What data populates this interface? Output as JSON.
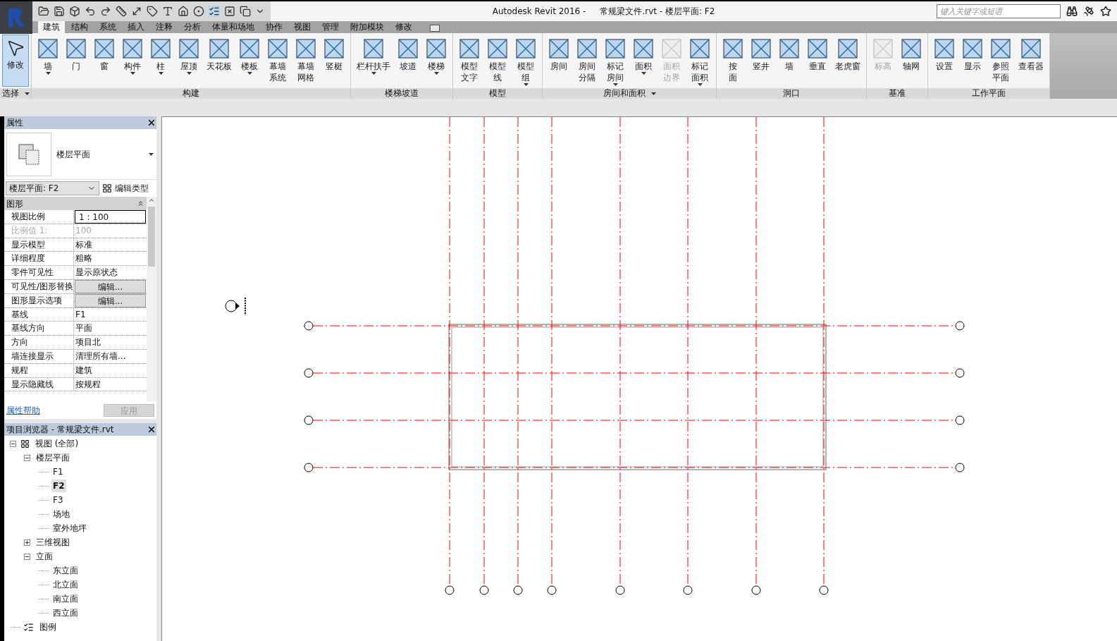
{
  "window": {
    "app_title": "Autodesk Revit 2016 -",
    "document_title": "常规梁文件.rvt - 楼层平面: F2"
  },
  "search": {
    "placeholder": "键入关键字或短语"
  },
  "tabs": [
    {
      "label": "建筑",
      "selected": true
    },
    {
      "label": "结构",
      "selected": false
    },
    {
      "label": "系统",
      "selected": false
    },
    {
      "label": "插入",
      "selected": false
    },
    {
      "label": "注释",
      "selected": false
    },
    {
      "label": "分析",
      "selected": false
    },
    {
      "label": "体量和场地",
      "selected": false
    },
    {
      "label": "协作",
      "selected": false
    },
    {
      "label": "视图",
      "selected": false
    },
    {
      "label": "管理",
      "selected": false
    },
    {
      "label": "附加模块",
      "selected": false
    },
    {
      "label": "修改",
      "selected": false
    }
  ],
  "ribbon": {
    "panels": [
      {
        "label": "选择",
        "menu": true,
        "buttons": [
          {
            "lines": [
              "修改"
            ],
            "menu": false,
            "disabled": false,
            "active": true
          }
        ]
      },
      {
        "label": "构建",
        "menu": false,
        "buttons": [
          {
            "lines": [
              "墙"
            ],
            "menu": true,
            "disabled": false,
            "active": false
          },
          {
            "lines": [
              "门"
            ],
            "menu": false,
            "disabled": false,
            "active": false
          },
          {
            "lines": [
              "窗"
            ],
            "menu": false,
            "disabled": false,
            "active": false
          },
          {
            "lines": [
              "构件"
            ],
            "menu": true,
            "disabled": false,
            "active": false
          },
          {
            "lines": [
              "柱"
            ],
            "menu": true,
            "disabled": false,
            "active": false
          },
          {
            "lines": [
              "屋顶"
            ],
            "menu": true,
            "disabled": false,
            "active": false
          },
          {
            "lines": [
              "天花板"
            ],
            "menu": false,
            "disabled": false,
            "active": false
          },
          {
            "lines": [
              "楼板"
            ],
            "menu": true,
            "disabled": false,
            "active": false
          },
          {
            "lines": [
              "幕墙",
              "系统"
            ],
            "menu": false,
            "disabled": false,
            "active": false
          },
          {
            "lines": [
              "幕墙",
              "网格"
            ],
            "menu": false,
            "disabled": false,
            "active": false
          },
          {
            "lines": [
              "竖梃"
            ],
            "menu": false,
            "disabled": false,
            "active": false
          }
        ]
      },
      {
        "label": "楼梯坡道",
        "menu": false,
        "buttons": [
          {
            "lines": [
              "栏杆扶手"
            ],
            "menu": true,
            "disabled": false,
            "active": false
          },
          {
            "lines": [
              "坡道"
            ],
            "menu": false,
            "disabled": false,
            "active": false
          },
          {
            "lines": [
              "楼梯"
            ],
            "menu": true,
            "disabled": false,
            "active": false
          }
        ]
      },
      {
        "label": "模型",
        "menu": false,
        "buttons": [
          {
            "lines": [
              "模型",
              "文字"
            ],
            "menu": false,
            "disabled": false,
            "active": false
          },
          {
            "lines": [
              "模型",
              "线"
            ],
            "menu": false,
            "disabled": false,
            "active": false
          },
          {
            "lines": [
              "模型",
              "组"
            ],
            "menu": true,
            "disabled": false,
            "active": false
          }
        ]
      },
      {
        "label": "房间和面积",
        "menu": true,
        "buttons": [
          {
            "lines": [
              "房间"
            ],
            "menu": false,
            "disabled": false,
            "active": false
          },
          {
            "lines": [
              "房间",
              "分隔"
            ],
            "menu": false,
            "disabled": false,
            "active": false
          },
          {
            "lines": [
              "标记",
              "房间"
            ],
            "menu": true,
            "disabled": false,
            "active": false
          },
          {
            "lines": [
              "面积"
            ],
            "menu": true,
            "disabled": false,
            "active": false
          },
          {
            "lines": [
              "面积",
              "边界"
            ],
            "menu": false,
            "disabled": true,
            "active": false
          },
          {
            "lines": [
              "标记",
              "面积"
            ],
            "menu": true,
            "disabled": false,
            "active": false
          }
        ]
      },
      {
        "label": "洞口",
        "menu": false,
        "buttons": [
          {
            "lines": [
              "按",
              "面"
            ],
            "menu": false,
            "disabled": false,
            "active": false
          },
          {
            "lines": [
              "竖井"
            ],
            "menu": false,
            "disabled": false,
            "active": false
          },
          {
            "lines": [
              "墙"
            ],
            "menu": false,
            "disabled": false,
            "active": false
          },
          {
            "lines": [
              "垂直"
            ],
            "menu": false,
            "disabled": false,
            "active": false
          },
          {
            "lines": [
              "老虎窗"
            ],
            "menu": false,
            "disabled": false,
            "active": false
          }
        ]
      },
      {
        "label": "基准",
        "menu": false,
        "buttons": [
          {
            "lines": [
              "标高"
            ],
            "menu": false,
            "disabled": true,
            "active": false
          },
          {
            "lines": [
              "轴网"
            ],
            "menu": false,
            "disabled": false,
            "active": false
          }
        ]
      },
      {
        "label": "工作平面",
        "menu": false,
        "buttons": [
          {
            "lines": [
              "设置"
            ],
            "menu": false,
            "disabled": false,
            "active": false
          },
          {
            "lines": [
              "显示"
            ],
            "menu": false,
            "disabled": false,
            "active": false
          },
          {
            "lines": [
              "参照",
              "平面"
            ],
            "menu": false,
            "disabled": false,
            "active": false
          },
          {
            "lines": [
              "查看器"
            ],
            "menu": false,
            "disabled": false,
            "active": false
          }
        ]
      }
    ]
  },
  "properties": {
    "title": "属性",
    "type_name": "楼层平面",
    "instance_selector": "楼层平面: F2",
    "edit_type": "编辑类型",
    "group": "图形",
    "rows": [
      {
        "name": "视图比例",
        "value": "1 : 100",
        "kind": "input",
        "disabled": false
      },
      {
        "name": "比例值 1:",
        "value": "100",
        "kind": "text",
        "disabled": true
      },
      {
        "name": "显示模型",
        "value": "标准",
        "kind": "text",
        "disabled": false
      },
      {
        "name": "详细程度",
        "value": "粗略",
        "kind": "text",
        "disabled": false
      },
      {
        "name": "零件可见性",
        "value": "显示原状态",
        "kind": "text",
        "disabled": false
      },
      {
        "name": "可见性/图形替换",
        "value": "编辑...",
        "kind": "button",
        "disabled": false
      },
      {
        "name": "图形显示选项",
        "value": "编辑...",
        "kind": "button",
        "disabled": false
      },
      {
        "name": "基线",
        "value": "F1",
        "kind": "text",
        "disabled": false
      },
      {
        "name": "基线方向",
        "value": "平面",
        "kind": "text",
        "disabled": false
      },
      {
        "name": "方向",
        "value": "项目北",
        "kind": "text",
        "disabled": false
      },
      {
        "name": "墙连接显示",
        "value": "清理所有墙...",
        "kind": "text",
        "disabled": false
      },
      {
        "name": "规程",
        "value": "建筑",
        "kind": "text",
        "disabled": false
      },
      {
        "name": "显示隐藏线",
        "value": "按规程",
        "kind": "text",
        "disabled": false
      }
    ],
    "help_link": "属性帮助",
    "apply": {
      "label": "应用",
      "disabled": true
    }
  },
  "browser": {
    "title": "项目浏览器 - 常规梁文件.rvt",
    "tree": [
      {
        "label": "视图 (全部)",
        "kind": "views",
        "expanded": true,
        "selected": false,
        "children": [
          {
            "label": "楼层平面",
            "expanded": true,
            "selected": false,
            "children": [
              {
                "label": "F1",
                "selected": false
              },
              {
                "label": "F2",
                "selected": true
              },
              {
                "label": "F3",
                "selected": false
              },
              {
                "label": "场地",
                "selected": false
              },
              {
                "label": "室外地坪",
                "selected": false
              }
            ]
          },
          {
            "label": "三维视图",
            "expanded": false,
            "selected": false
          },
          {
            "label": "立面",
            "expanded": true,
            "selected": false,
            "children": [
              {
                "label": "东立面",
                "selected": false
              },
              {
                "label": "北立面",
                "selected": false
              },
              {
                "label": "南立面",
                "selected": false
              },
              {
                "label": "西立面",
                "selected": false
              }
            ]
          }
        ]
      },
      {
        "label": "图例",
        "kind": "legend",
        "selected": false
      }
    ]
  }
}
